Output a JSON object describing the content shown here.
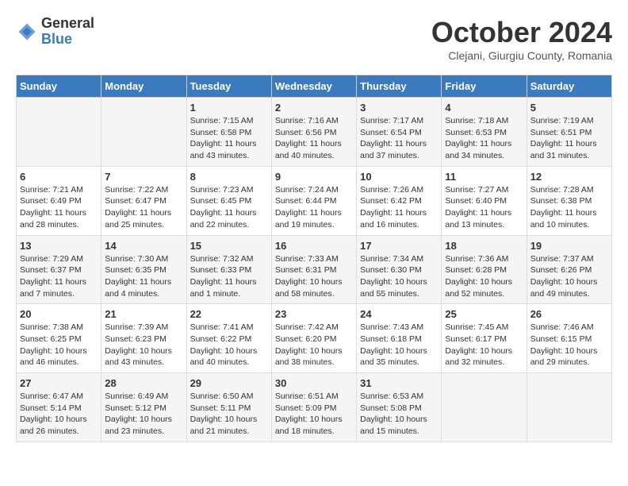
{
  "header": {
    "logo_general": "General",
    "logo_blue": "Blue",
    "title": "October 2024",
    "subtitle": "Clejani, Giurgiu County, Romania"
  },
  "days_of_week": [
    "Sunday",
    "Monday",
    "Tuesday",
    "Wednesday",
    "Thursday",
    "Friday",
    "Saturday"
  ],
  "weeks": [
    [
      {
        "day": "",
        "info": ""
      },
      {
        "day": "",
        "info": ""
      },
      {
        "day": "1",
        "info": "Sunrise: 7:15 AM\nSunset: 6:58 PM\nDaylight: 11 hours and 43 minutes."
      },
      {
        "day": "2",
        "info": "Sunrise: 7:16 AM\nSunset: 6:56 PM\nDaylight: 11 hours and 40 minutes."
      },
      {
        "day": "3",
        "info": "Sunrise: 7:17 AM\nSunset: 6:54 PM\nDaylight: 11 hours and 37 minutes."
      },
      {
        "day": "4",
        "info": "Sunrise: 7:18 AM\nSunset: 6:53 PM\nDaylight: 11 hours and 34 minutes."
      },
      {
        "day": "5",
        "info": "Sunrise: 7:19 AM\nSunset: 6:51 PM\nDaylight: 11 hours and 31 minutes."
      }
    ],
    [
      {
        "day": "6",
        "info": "Sunrise: 7:21 AM\nSunset: 6:49 PM\nDaylight: 11 hours and 28 minutes."
      },
      {
        "day": "7",
        "info": "Sunrise: 7:22 AM\nSunset: 6:47 PM\nDaylight: 11 hours and 25 minutes."
      },
      {
        "day": "8",
        "info": "Sunrise: 7:23 AM\nSunset: 6:45 PM\nDaylight: 11 hours and 22 minutes."
      },
      {
        "day": "9",
        "info": "Sunrise: 7:24 AM\nSunset: 6:44 PM\nDaylight: 11 hours and 19 minutes."
      },
      {
        "day": "10",
        "info": "Sunrise: 7:26 AM\nSunset: 6:42 PM\nDaylight: 11 hours and 16 minutes."
      },
      {
        "day": "11",
        "info": "Sunrise: 7:27 AM\nSunset: 6:40 PM\nDaylight: 11 hours and 13 minutes."
      },
      {
        "day": "12",
        "info": "Sunrise: 7:28 AM\nSunset: 6:38 PM\nDaylight: 11 hours and 10 minutes."
      }
    ],
    [
      {
        "day": "13",
        "info": "Sunrise: 7:29 AM\nSunset: 6:37 PM\nDaylight: 11 hours and 7 minutes."
      },
      {
        "day": "14",
        "info": "Sunrise: 7:30 AM\nSunset: 6:35 PM\nDaylight: 11 hours and 4 minutes."
      },
      {
        "day": "15",
        "info": "Sunrise: 7:32 AM\nSunset: 6:33 PM\nDaylight: 11 hours and 1 minute."
      },
      {
        "day": "16",
        "info": "Sunrise: 7:33 AM\nSunset: 6:31 PM\nDaylight: 10 hours and 58 minutes."
      },
      {
        "day": "17",
        "info": "Sunrise: 7:34 AM\nSunset: 6:30 PM\nDaylight: 10 hours and 55 minutes."
      },
      {
        "day": "18",
        "info": "Sunrise: 7:36 AM\nSunset: 6:28 PM\nDaylight: 10 hours and 52 minutes."
      },
      {
        "day": "19",
        "info": "Sunrise: 7:37 AM\nSunset: 6:26 PM\nDaylight: 10 hours and 49 minutes."
      }
    ],
    [
      {
        "day": "20",
        "info": "Sunrise: 7:38 AM\nSunset: 6:25 PM\nDaylight: 10 hours and 46 minutes."
      },
      {
        "day": "21",
        "info": "Sunrise: 7:39 AM\nSunset: 6:23 PM\nDaylight: 10 hours and 43 minutes."
      },
      {
        "day": "22",
        "info": "Sunrise: 7:41 AM\nSunset: 6:22 PM\nDaylight: 10 hours and 40 minutes."
      },
      {
        "day": "23",
        "info": "Sunrise: 7:42 AM\nSunset: 6:20 PM\nDaylight: 10 hours and 38 minutes."
      },
      {
        "day": "24",
        "info": "Sunrise: 7:43 AM\nSunset: 6:18 PM\nDaylight: 10 hours and 35 minutes."
      },
      {
        "day": "25",
        "info": "Sunrise: 7:45 AM\nSunset: 6:17 PM\nDaylight: 10 hours and 32 minutes."
      },
      {
        "day": "26",
        "info": "Sunrise: 7:46 AM\nSunset: 6:15 PM\nDaylight: 10 hours and 29 minutes."
      }
    ],
    [
      {
        "day": "27",
        "info": "Sunrise: 6:47 AM\nSunset: 5:14 PM\nDaylight: 10 hours and 26 minutes."
      },
      {
        "day": "28",
        "info": "Sunrise: 6:49 AM\nSunset: 5:12 PM\nDaylight: 10 hours and 23 minutes."
      },
      {
        "day": "29",
        "info": "Sunrise: 6:50 AM\nSunset: 5:11 PM\nDaylight: 10 hours and 21 minutes."
      },
      {
        "day": "30",
        "info": "Sunrise: 6:51 AM\nSunset: 5:09 PM\nDaylight: 10 hours and 18 minutes."
      },
      {
        "day": "31",
        "info": "Sunrise: 6:53 AM\nSunset: 5:08 PM\nDaylight: 10 hours and 15 minutes."
      },
      {
        "day": "",
        "info": ""
      },
      {
        "day": "",
        "info": ""
      }
    ]
  ]
}
